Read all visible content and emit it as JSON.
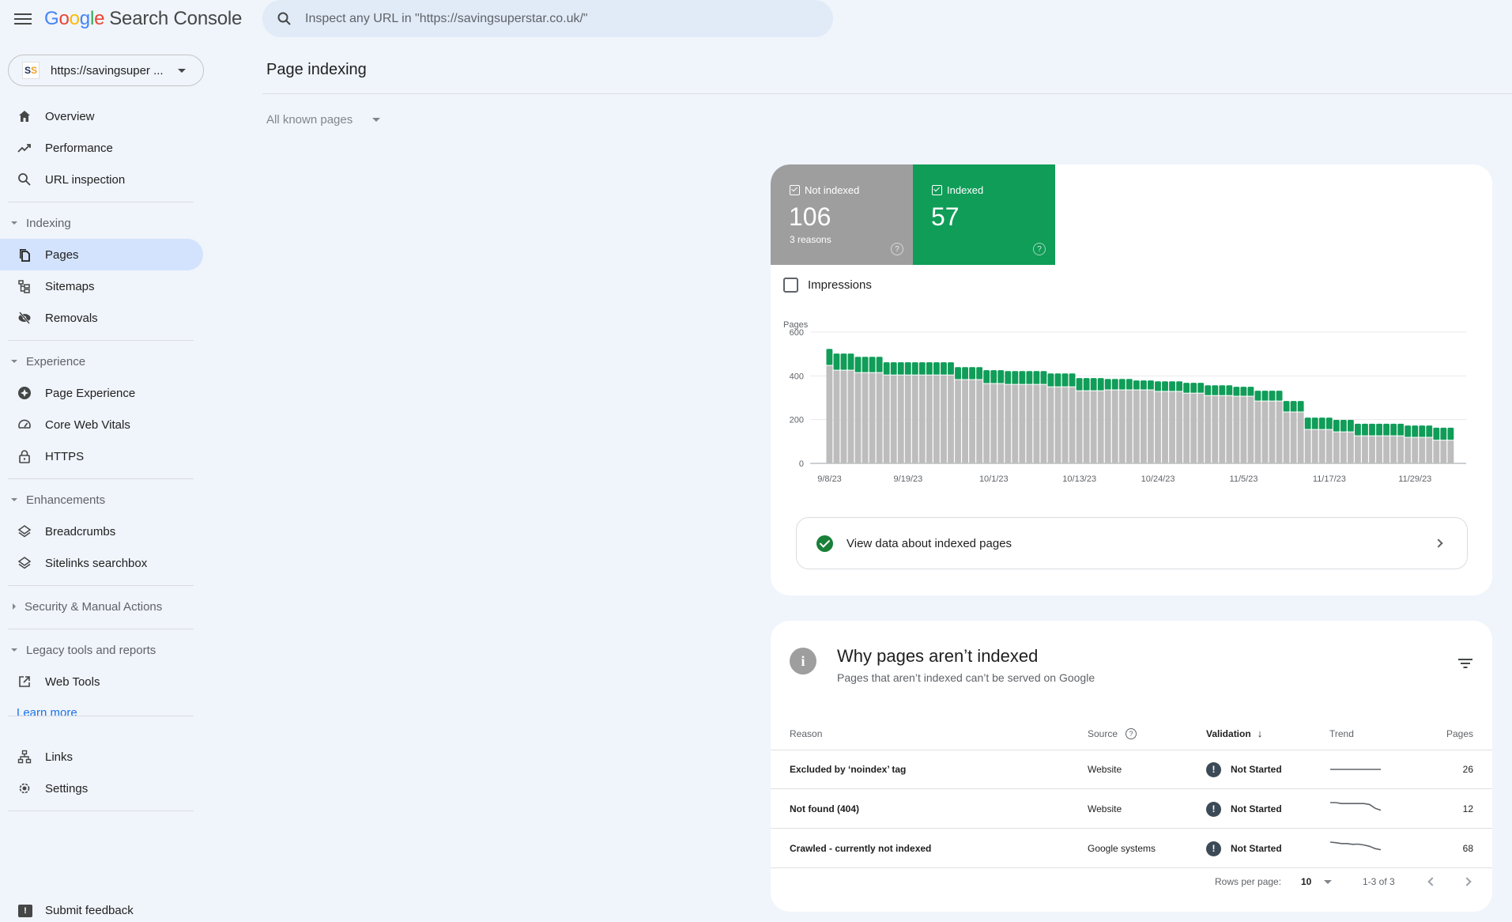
{
  "app": {
    "logo_letters": [
      "G",
      "o",
      "o",
      "g",
      "l",
      "e"
    ],
    "product_name": "Search Console",
    "menu_icon": "hamburger-menu-icon"
  },
  "search": {
    "placeholder": "Inspect any URL in \"https://savingsuperstar.co.uk/\"",
    "value": "",
    "icon": "search-icon"
  },
  "property": {
    "logo_text_1": "S",
    "logo_text_2": "S",
    "label": "https://savingsuper ..."
  },
  "sidebar": {
    "top_items": [
      {
        "label": "Overview",
        "icon": "home-icon"
      },
      {
        "label": "Performance",
        "icon": "trending-up-icon"
      },
      {
        "label": "URL inspection",
        "icon": "search-icon"
      }
    ],
    "sections": [
      {
        "label": "Indexing",
        "expanded": true,
        "items": [
          {
            "label": "Pages",
            "icon": "pages-icon",
            "active": true
          },
          {
            "label": "Sitemaps",
            "icon": "sitemap-icon"
          },
          {
            "label": "Removals",
            "icon": "eye-off-icon"
          }
        ]
      },
      {
        "label": "Experience",
        "expanded": true,
        "items": [
          {
            "label": "Page Experience",
            "icon": "page-experience-icon"
          },
          {
            "label": "Core Web Vitals",
            "icon": "speedometer-icon"
          },
          {
            "label": "HTTPS",
            "icon": "lock-icon"
          }
        ]
      },
      {
        "label": "Enhancements",
        "expanded": true,
        "items": [
          {
            "label": "Breadcrumbs",
            "icon": "layers-icon"
          },
          {
            "label": "Sitelinks searchbox",
            "icon": "layers-icon"
          }
        ]
      },
      {
        "label": "Security & Manual Actions",
        "expanded": false,
        "items": []
      },
      {
        "label": "Legacy tools and reports",
        "expanded": true,
        "items": [
          {
            "label": "Web Tools",
            "icon": "external-link-icon"
          }
        ]
      }
    ],
    "learn_more": "Learn more",
    "bottom_items": [
      {
        "label": "Links",
        "icon": "links-icon"
      },
      {
        "label": "Settings",
        "icon": "gear-icon"
      }
    ],
    "feedback": {
      "label": "Submit feedback",
      "icon": "feedback-icon"
    }
  },
  "main": {
    "title": "Page indexing",
    "filter": "All known pages",
    "summary": {
      "not_indexed": {
        "label": "Not indexed",
        "value": "106",
        "sub": "3 reasons",
        "checked": true,
        "color": "#9e9e9e"
      },
      "indexed": {
        "label": "Indexed",
        "value": "57",
        "checked": true,
        "color": "#0f9d58"
      }
    },
    "impressions_label": "Impressions",
    "impressions_checked": false,
    "view_data_label": "View data about indexed pages",
    "why": {
      "title": "Why pages aren’t indexed",
      "subtitle": "Pages that aren’t indexed can’t be served on Google",
      "columns": {
        "reason": "Reason",
        "source": "Source",
        "validation": "Validation",
        "trend": "Trend",
        "pages": "Pages"
      },
      "rows": [
        {
          "reason": "Excluded by ‘noindex’ tag",
          "source": "Website",
          "validation": "Not Started",
          "pages": "26",
          "trend": [
            26,
            26,
            26,
            26,
            26,
            26,
            26,
            26,
            26,
            26
          ]
        },
        {
          "reason": "Not found (404)",
          "source": "Website",
          "validation": "Not Started",
          "pages": "12",
          "trend": [
            20,
            20,
            19,
            19,
            19,
            19,
            19,
            18,
            14,
            12
          ]
        },
        {
          "reason": "Crawled - currently not indexed",
          "source": "Google systems",
          "validation": "Not Started",
          "pages": "68",
          "trend": [
            95,
            93,
            90,
            90,
            87,
            88,
            85,
            80,
            72,
            68
          ]
        }
      ],
      "pagination": {
        "rows_per_page_label": "Rows per page:",
        "rows_per_page": "10",
        "range": "1-3 of 3"
      }
    }
  },
  "chart_data": {
    "type": "bar",
    "stacked": true,
    "title": "",
    "ylabel": "Pages",
    "xlabel": "",
    "ylim": [
      0,
      600
    ],
    "yticks": [
      0,
      200,
      400,
      600
    ],
    "grid": true,
    "start_date": "9/8/23",
    "xtick_labels": [
      "9/8/23",
      "9/19/23",
      "10/1/23",
      "10/13/23",
      "10/24/23",
      "11/5/23",
      "11/17/23",
      "11/29/23"
    ],
    "xtick_indices": [
      0,
      11,
      23,
      35,
      46,
      58,
      70,
      82
    ],
    "series": [
      {
        "name": "Not indexed",
        "color": "#bdbdbd",
        "values": [
          448,
          426,
          426,
          426,
          415,
          415,
          415,
          415,
          404,
          404,
          404,
          404,
          404,
          404,
          404,
          404,
          404,
          404,
          383,
          383,
          383,
          383,
          365,
          365,
          365,
          361,
          361,
          361,
          361,
          361,
          361,
          350,
          350,
          350,
          350,
          332,
          332,
          332,
          332,
          336,
          336,
          336,
          336,
          336,
          336,
          336,
          329,
          329,
          329,
          329,
          321,
          321,
          321,
          310,
          310,
          310,
          310,
          307,
          307,
          307,
          285,
          285,
          285,
          285,
          235,
          235,
          235,
          155,
          155,
          155,
          155,
          144,
          144,
          144,
          126,
          126,
          126,
          126,
          126,
          126,
          126,
          119,
          119,
          119,
          119,
          106,
          106,
          106
        ]
      },
      {
        "name": "Indexed",
        "color": "#0f9d58",
        "values": [
          75,
          76,
          76,
          76,
          72,
          72,
          72,
          72,
          58,
          58,
          58,
          58,
          58,
          58,
          58,
          58,
          58,
          58,
          57,
          57,
          57,
          57,
          61,
          61,
          61,
          61,
          61,
          61,
          61,
          61,
          61,
          61,
          61,
          61,
          61,
          58,
          58,
          58,
          58,
          50,
          50,
          50,
          50,
          43,
          43,
          43,
          46,
          46,
          46,
          46,
          47,
          47,
          47,
          47,
          47,
          47,
          47,
          43,
          43,
          43,
          47,
          47,
          47,
          47,
          50,
          50,
          50,
          54,
          54,
          54,
          54,
          55,
          55,
          55,
          55,
          55,
          55,
          55,
          55,
          55,
          55,
          54,
          54,
          54,
          54,
          57,
          57,
          57
        ]
      }
    ]
  }
}
